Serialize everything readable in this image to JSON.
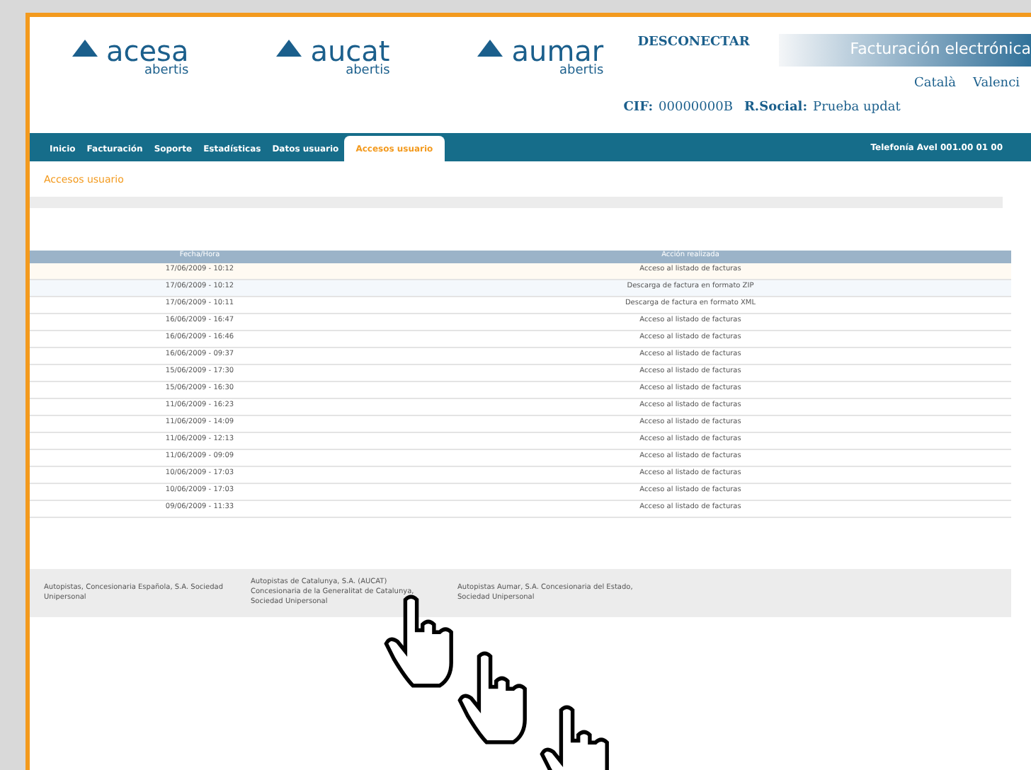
{
  "header": {
    "logos": [
      {
        "name": "acesa",
        "sub": "abertis"
      },
      {
        "name": "aucat",
        "sub": "abertis"
      },
      {
        "name": "aumar",
        "sub": "abertis"
      }
    ],
    "disconnect": "DESCONECTAR",
    "banner": "Facturación electrónica",
    "languages": [
      "Català",
      "Valenci"
    ],
    "cif_label": "CIF:",
    "cif_value": "00000000B",
    "social_label": "R.Social:",
    "social_value": "Prueba updat"
  },
  "nav": {
    "tabs": [
      {
        "label": "Inicio",
        "selected": false
      },
      {
        "label": "Facturación",
        "selected": false
      },
      {
        "label": "Soporte",
        "selected": false
      },
      {
        "label": "Estadísticas",
        "selected": false
      },
      {
        "label": "Datos usuario",
        "selected": false
      },
      {
        "label": "Accesos usuario",
        "selected": true
      }
    ],
    "user": "Telefonía Avel 001.00 01 00"
  },
  "section_title": "Accesos usuario",
  "table": {
    "columns": [
      "Fecha/Hora",
      "Acción realizada"
    ],
    "rows": [
      [
        "17/06/2009 - 10:12",
        "Acceso al listado de facturas"
      ],
      [
        "17/06/2009 - 10:12",
        "Descarga de factura en formato ZIP"
      ],
      [
        "17/06/2009 - 10:11",
        "Descarga de factura en formato XML"
      ],
      [
        "16/06/2009 - 16:47",
        "Acceso al listado de facturas"
      ],
      [
        "16/06/2009 - 16:46",
        "Acceso al listado de facturas"
      ],
      [
        "16/06/2009 - 09:37",
        "Acceso al listado de facturas"
      ],
      [
        "15/06/2009 - 17:30",
        "Acceso al listado de facturas"
      ],
      [
        "15/06/2009 - 16:30",
        "Acceso al listado de facturas"
      ],
      [
        "11/06/2009 - 16:23",
        "Acceso al listado de facturas"
      ],
      [
        "11/06/2009 - 14:09",
        "Acceso al listado de facturas"
      ],
      [
        "11/06/2009 - 12:13",
        "Acceso al listado de facturas"
      ],
      [
        "11/06/2009 - 09:09",
        "Acceso al listado de facturas"
      ],
      [
        "10/06/2009 - 17:03",
        "Acceso al listado de facturas"
      ],
      [
        "10/06/2009 - 17:03",
        "Acceso al listado de facturas"
      ],
      [
        "09/06/2009 - 11:33",
        "Acceso al listado de facturas"
      ]
    ]
  },
  "footer": [
    "Autopistas, Concesionaria Española, S.A. Sociedad Unipersonal",
    "Autopistas de Catalunya, S.A. (AUCAT) Concesionaria de la Generalitat de Catalunya, Sociedad Unipersonal",
    "Autopistas Aumar, S.A. Concesionaria del Estado, Sociedad Unipersonal"
  ]
}
